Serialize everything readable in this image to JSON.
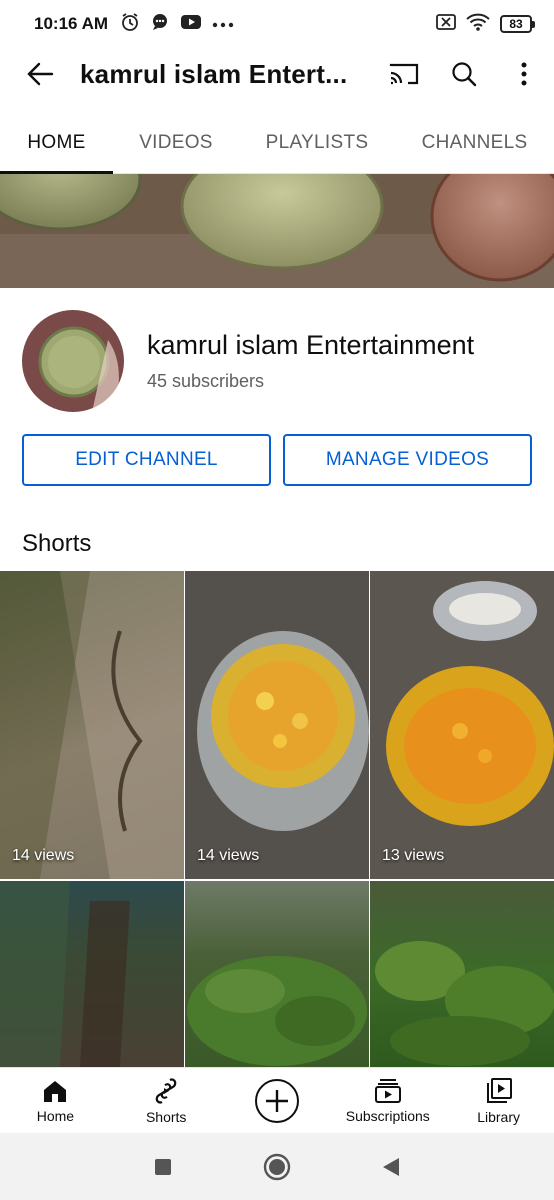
{
  "status_bar": {
    "time": "10:16 AM",
    "battery": "83"
  },
  "app_bar": {
    "title": "kamrul islam Entert..."
  },
  "tabs": [
    {
      "label": "HOME",
      "active": true
    },
    {
      "label": "VIDEOS",
      "active": false
    },
    {
      "label": "PLAYLISTS",
      "active": false
    },
    {
      "label": "CHANNELS",
      "active": false
    }
  ],
  "channel": {
    "name": "kamrul islam Entertainment",
    "subscribers": "45 subscribers"
  },
  "buttons": {
    "edit_channel": "EDIT CHANNEL",
    "manage_videos": "MANAGE VIDEOS"
  },
  "shorts": {
    "heading": "Shorts",
    "items": [
      {
        "views": "14 views"
      },
      {
        "views": "14 views"
      },
      {
        "views": "13 views"
      },
      {
        "views": ""
      },
      {
        "views": ""
      },
      {
        "views": ""
      }
    ]
  },
  "bottom_nav": [
    {
      "label": "Home",
      "icon": "home-icon"
    },
    {
      "label": "Shorts",
      "icon": "shorts-icon"
    },
    {
      "label": "",
      "icon": "create-icon"
    },
    {
      "label": "Subscriptions",
      "icon": "subscriptions-icon"
    },
    {
      "label": "Library",
      "icon": "library-icon"
    }
  ],
  "colors": {
    "accent_blue": "#065fd4",
    "text_primary": "#0f0f0f",
    "text_secondary": "#606060"
  }
}
